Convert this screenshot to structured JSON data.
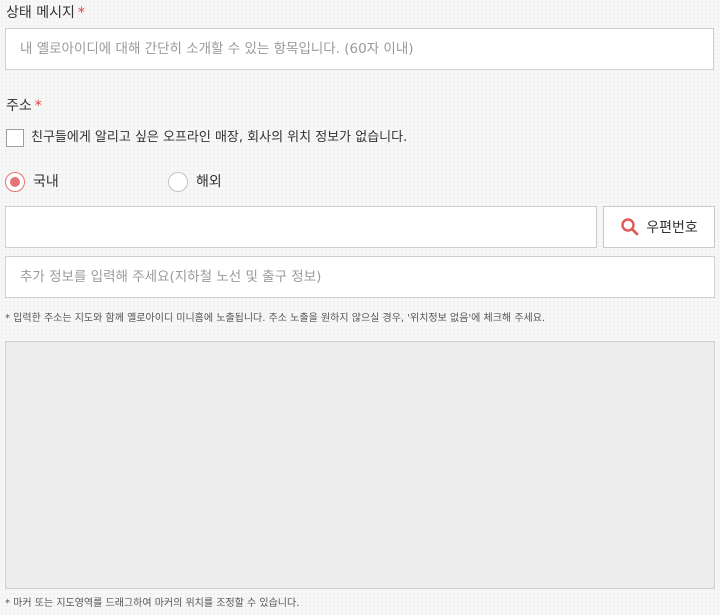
{
  "status_message": {
    "label": "상태 메시지",
    "required_mark": "*",
    "placeholder": "내 옐로아이디에 대해 간단히 소개할 수 있는 항목입니다. (60자 이내)"
  },
  "address": {
    "label": "주소",
    "required_mark": "*",
    "no_location_checkbox_label": "친구들에게 알리고 싶은 오프라인 매장, 회사의 위치 정보가 없습니다.",
    "no_location_checked": false,
    "region_options": [
      {
        "label": "국내",
        "selected": true
      },
      {
        "label": "해외",
        "selected": false
      }
    ],
    "address_value": "",
    "zipcode_button_label": "우편번호",
    "extra_info_placeholder": "추가 정보를 입력해 주세요(지하철 노선 및 출구 정보)",
    "notice": "* 입력한 주소는 지도와 함께 옐로아이디 미니홈에 노출됩니다. 주소 노출을 원하지 않으실 경우, '위치정보 없음'에 체크해 주세요.",
    "map_hint": "* 마커 또는 지도영역를 드래그하여 마커의 위치를 조정할 수 있습니다."
  },
  "colors": {
    "required": "#e03c3c",
    "radio_selected": "#e57373",
    "search_icon": "#e05a5a"
  }
}
